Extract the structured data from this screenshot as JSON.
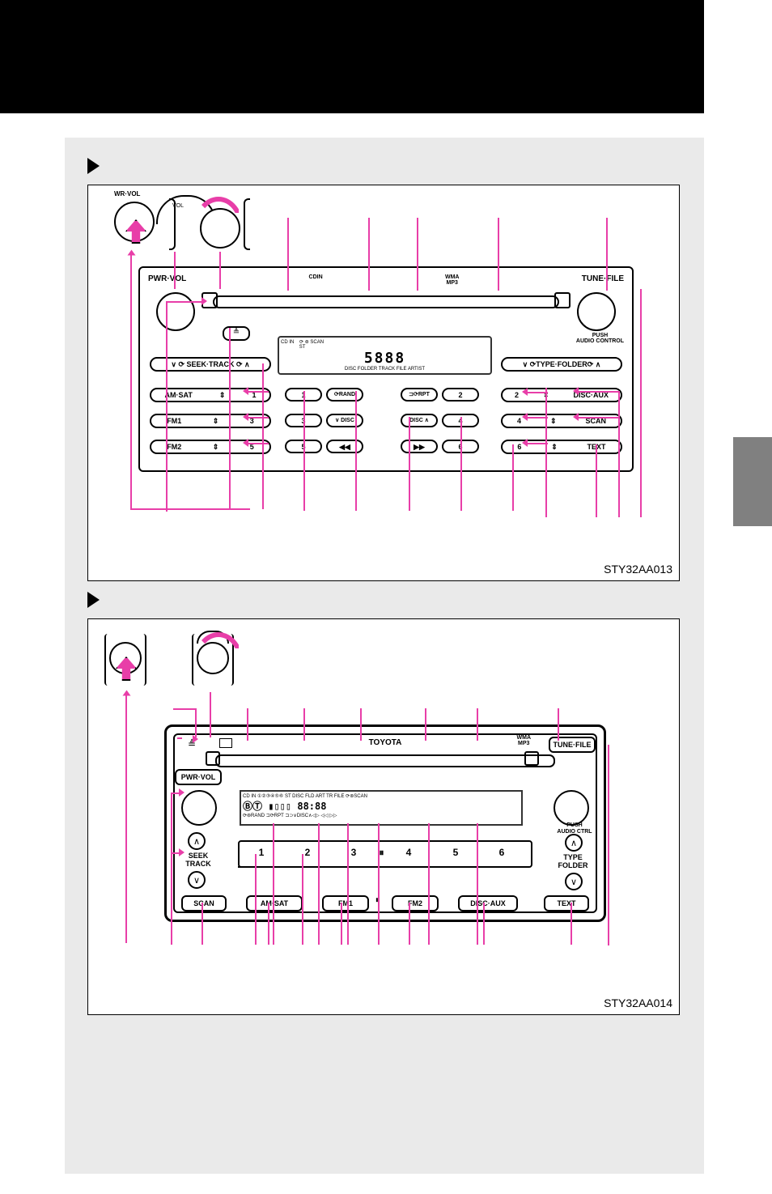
{
  "figure_codes": {
    "a": "STY32AA013",
    "b": "STY32AA014"
  },
  "typeA": {
    "top_left_label": "WR·VOL",
    "vol_label": "VOL",
    "pwr_vol": "PWR·VOL",
    "tune_file": "TUNE·FILE",
    "cdin": "CDIN",
    "wma_mp3": "WMA\nMP3",
    "audio_control": "PUSH\nAUDIO CONTROL",
    "seek_track": "∨ ⟳ SEEK·TRACK ⟳ ∧",
    "type_folder": "∨ ⟳TYPE·FOLDER⟳ ∧",
    "eject": "≜",
    "lcd": "5888",
    "lcd_indicators": "CD IN    ⟳ ⊚ SCAN\nST",
    "lcd_line2": "DISC  FOLDER TRACK FILE            ARTIST",
    "am_sat": "AM·SAT",
    "disc_aux": "DISC·AUX",
    "fm1": "FM1",
    "scan": "SCAN",
    "fm2": "FM2",
    "text": "TEXT",
    "p1": "1",
    "p3": "3",
    "p5": "5",
    "p2": "2",
    "p4": "4",
    "p6": "6",
    "pill1": "1",
    "pill2": "2",
    "pill3": "3",
    "pill4": "4",
    "pill5": "5",
    "pill6": "6",
    "pill_rand": "⟳RAND",
    "pill_rpt": "⊐⟳RPT",
    "pill_vdisc": "∨ DISC",
    "pill_disca": "DISC ∧",
    "pill_rr": "◀◀",
    "pill_ff": "▶▶"
  },
  "typeB": {
    "eject": "≜",
    "brand": "TOYOTA",
    "wma_mp3": "WMA\nMP3",
    "tune_file": "TUNE·FILE",
    "pwr_vol": "PWR·VOL",
    "audio_ctrl": "PUSH\nAUDIO CTRL",
    "seek_track": "SEEK\nTRACK",
    "type_folder": "TYPE\nFOLDER",
    "scan": "SCAN",
    "am_sat": "AM·SAT",
    "fm1": "FM1",
    "fm2": "FM2",
    "disc_aux": "DISC·AUX",
    "text": "TEXT",
    "disp_top": "CD IN ①②③④⑤⑥  ST  DISC    FLD  ART  TR  FILE        ⟳⊚SCAN",
    "disp_main": "ⒷⓉ ▮▯▯▯ 88:88",
    "disp_bot": "⟳⊚RAND   ⊐⟳RPT   ⊐⊃∨DISC∧◁▷   ◁◁   ▷▷",
    "n1": "1",
    "n2": "2",
    "n3": "3",
    "n4": "4",
    "n5": "5",
    "n6": "6",
    "pause": "⏸"
  }
}
